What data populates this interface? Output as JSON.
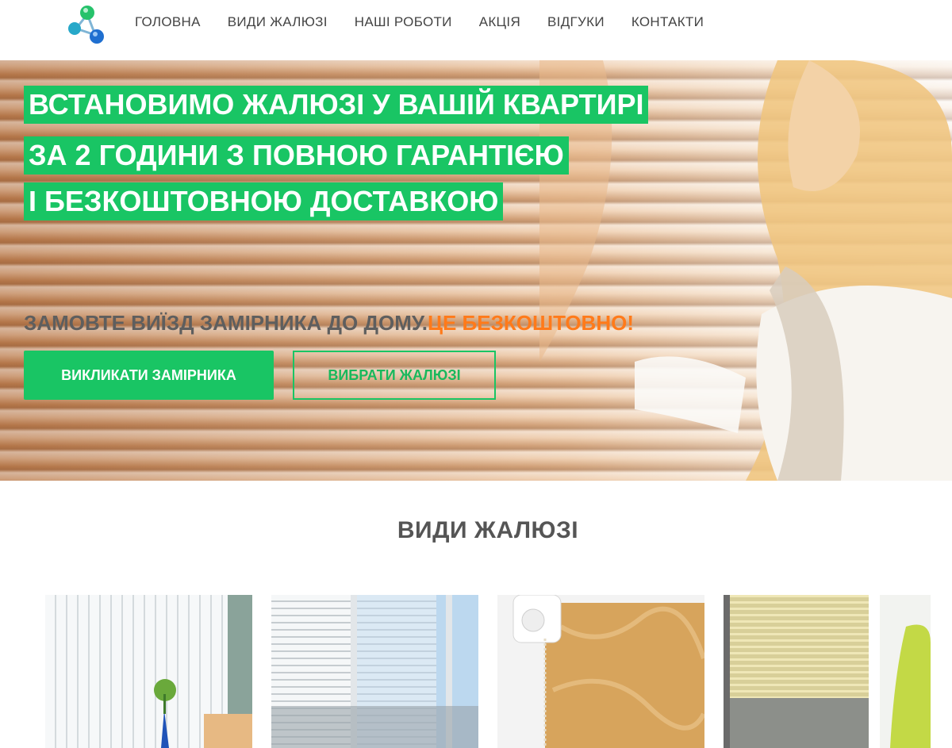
{
  "nav": {
    "logo_icon": "molecule-logo-icon",
    "items": [
      {
        "label": "ГОЛОВНА"
      },
      {
        "label": "ВИДИ ЖАЛЮЗІ"
      },
      {
        "label": "НАШІ РОБОТИ"
      },
      {
        "label": "АКЦІЯ"
      },
      {
        "label": "ВІДГУКИ"
      },
      {
        "label": "КОНТАКТИ"
      }
    ]
  },
  "hero": {
    "headline": [
      "ВСТАНОВИМО ЖАЛЮЗІ У ВАШІЙ КВАРТИРІ",
      "ЗА 2 ГОДИНИ З ПОВНОЮ ГАРАНТІЄЮ",
      "І БЕЗКОШТОВНОЮ ДОСТАВКОЮ"
    ],
    "subline_main": "ЗАМОВТЕ ВИЇЗД ЗАМІРНИКА ДО ДОМУ.",
    "subline_accent": "ЦЕ БЕЗКОШТОВНО!",
    "primary_button": "ВИКЛИКАТИ ЗАМІРНИКА",
    "secondary_button": "ВИБРАТИ ЖАЛЮЗІ"
  },
  "section": {
    "title": "ВИДИ ЖАЛЮЗІ",
    "cards": [
      {
        "image": "vertical-blinds-photo"
      },
      {
        "image": "horizontal-blinds-photo"
      },
      {
        "image": "roller-blinds-photo"
      },
      {
        "image": "pleated-blinds-photo"
      }
    ]
  },
  "colors": {
    "accent_green": "#19c564",
    "accent_orange": "#ff7a1a",
    "text_gray": "#555555"
  }
}
